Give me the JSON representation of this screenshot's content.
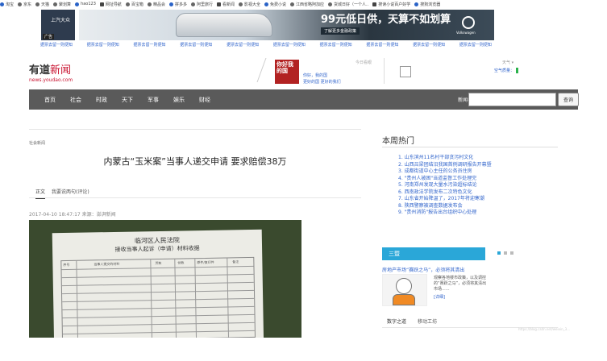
{
  "bookmarks": [
    "淘宝",
    "京东",
    "天猫",
    "聚划算",
    "hao123",
    "网址导航",
    "百宝箱",
    "精品会",
    "拼多多",
    "阿里旅行",
    "看新闻",
    "影视大全",
    "免费小说",
    "江西省略阿加应",
    "货城日好（一个人..",
    "搜读小说百户好学",
    "搜狗浏览器"
  ],
  "ad": {
    "left_tag": "广告",
    "left_logo": "上汽大众",
    "headline": "99元低日供，天算不如划算",
    "sub": "了解更多金融政策",
    "brand": "Volkswagen",
    "links": [
      "据票去留一则便知",
      "据票去留一则便知",
      "据票去留一则便知",
      "据票去留一则便知",
      "据票去留一则便知",
      "据票去留一则便知",
      "据票去留一则便知",
      "据票去留一则便知",
      "据票去留一则便知",
      "据票去留一则便知"
    ]
  },
  "header": {
    "logo": "有道",
    "logo_news": "新闻",
    "logo_url": "news.youdao.com",
    "promo_img_text": "你好我的国",
    "promo_line1": "你好，我的国",
    "promo_line2": "更好的国 更好的我们",
    "promo_date": "今日看眼",
    "weather_day": "天气 ▾",
    "air_label": "空气质量："
  },
  "nav": {
    "items": [
      "首页",
      "社会",
      "时政",
      "天下",
      "军事",
      "娱乐",
      "财经"
    ],
    "search_label": "新闻名",
    "search_placeholder": "",
    "search_button": "查询"
  },
  "article": {
    "breadcrumb": "社会新闻",
    "headline": "内蒙古“玉米案”当事人递交申请 要求赔偿38万",
    "tabs": [
      "正文",
      "我要说两句(评论)"
    ],
    "meta": "2017-04-10 18:47:17 来源：澎湃新闻",
    "photo": {
      "title1": "临河区人民法院",
      "title2": "接收当事人起诉（申请）材料收据",
      "headers": [
        "序号",
        "当事人提交的材料",
        "页数",
        "份数",
        "原件/复印件",
        "备注"
      ]
    }
  },
  "sidebar": {
    "title": "本周热门",
    "hot": [
      "1. 山东滨州11名村干部贪污村文化",
      "2. 山西吕梁团结沿我国首例调研报告开幕暨",
      "3. 成都街道中心主任的公务员住房",
      "4. \"贵州人被困\"当道监督工作处理完",
      "5. 河南郑州发现大量水污染超标结论",
      "6. 西南政法学院发布二次特色文化",
      "7. 山东省开始降温了，2017年将迎寒潮",
      "8. 陕西警察被调查数据发布会",
      "9. \"贵州消防\"报告出台组织中心处理"
    ],
    "banner": "三暨",
    "news_title": "房地产市场“赛跃之马”，必须将其清出",
    "news_text": "观察各地楼市政策，以及调控的“赛跃之马”，必须将其清出市场......",
    "news_more": "[详细]",
    "tabs": [
      "数字之道",
      "移动工坊"
    ]
  },
  "watermark": "https://blog.csdn.net/weixin_3..."
}
